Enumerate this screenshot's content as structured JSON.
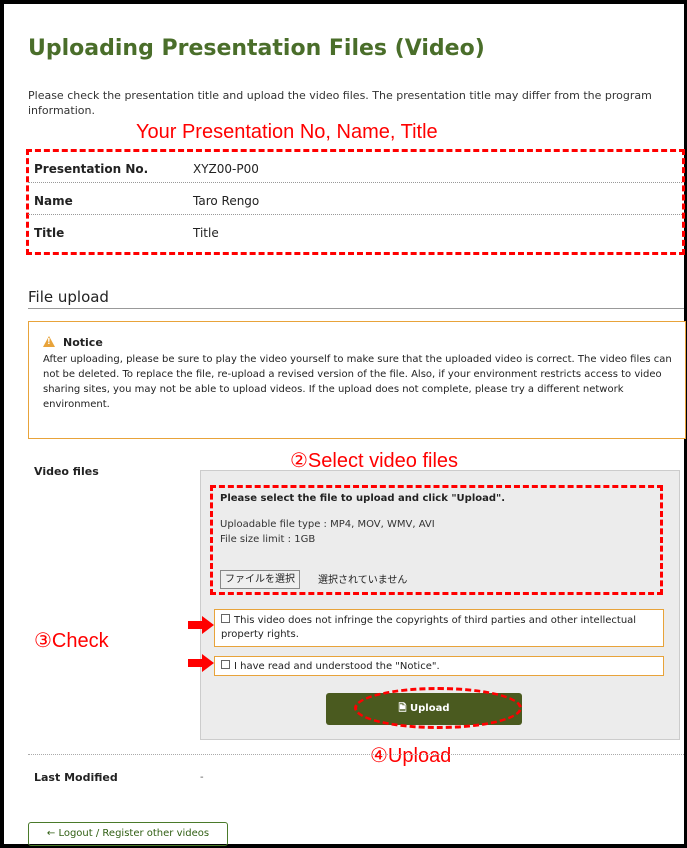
{
  "page": {
    "title": "Uploading Presentation Files (Video)",
    "intro": "Please check the presentation title and upload the video files. The presentation title may differ from the program information."
  },
  "annotations": {
    "info_box": "Your Presentation No, Name, Title",
    "select_video": "②Select video files",
    "check": "③Check",
    "upload": "④Upload",
    "color": "#ff0000"
  },
  "info": {
    "rows": [
      {
        "label": "Presentation No.",
        "value": "XYZ00-P00"
      },
      {
        "label": "Name",
        "value": "Taro Rengo"
      },
      {
        "label": "Title",
        "value": "Title"
      }
    ]
  },
  "file_upload": {
    "heading": "File upload",
    "notice_title": "Notice",
    "notice_icon": "warning-icon",
    "notice_text": "After uploading, please be sure to play the video yourself to make sure that the uploaded video is correct. The video files can not be deleted. To replace the file, re-upload a revised version of the file. Also, if your environment restricts access to video sharing sites, you may not be able to upload videos. If the upload does not complete, please try a different network environment.",
    "video_label": "Video files",
    "instruction": "Please select the file to upload and click \"Upload\".",
    "file_types": "Uploadable file type : MP4, MOV, WMV, AVI",
    "size_limit": "File size limit : 1GB",
    "choose_file_label": "ファイルを選択",
    "no_file_label": "選択されていません",
    "checkbox_copyright": "This video does not infringe the copyrights of third parties and other intellectual property rights.",
    "checkbox_notice": "I have read and understood the \"Notice\".",
    "upload_button": "Upload",
    "upload_icon": "file-icon"
  },
  "last_modified": {
    "label": "Last Modified",
    "value": "-"
  },
  "back_button": "← Logout / Register other videos",
  "colors": {
    "title": "#4a6e2a",
    "upload_button": "#4a5a1f",
    "notice_border": "#e8a33a"
  }
}
